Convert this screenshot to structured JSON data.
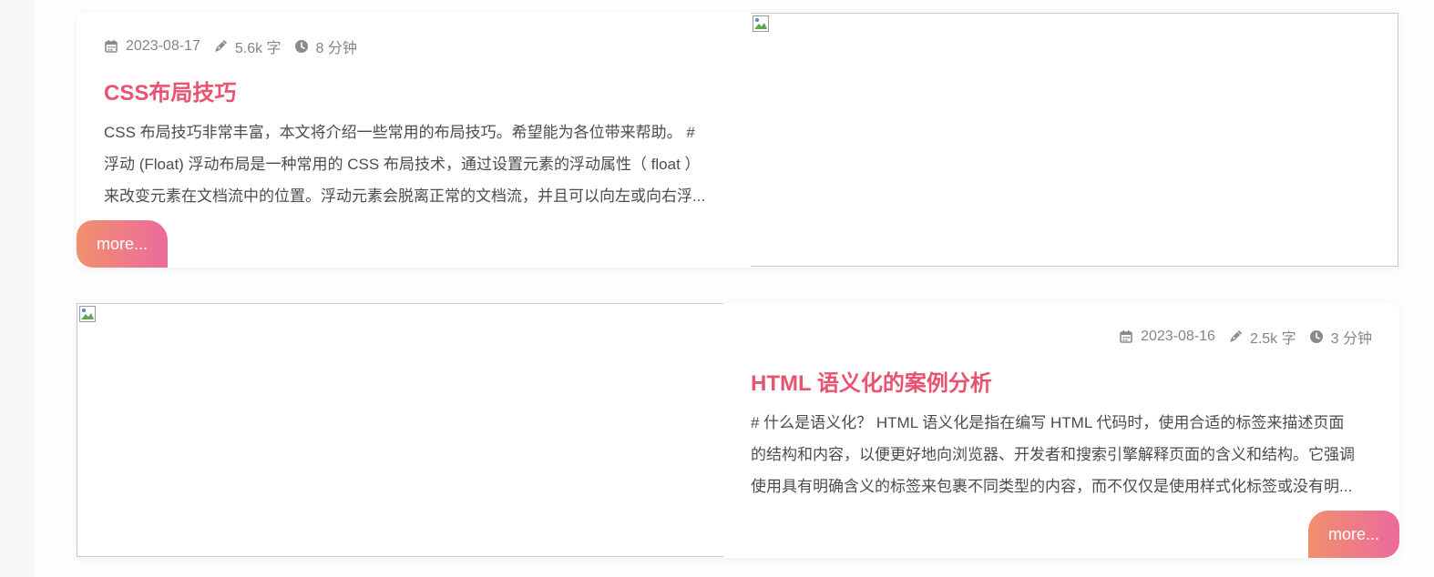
{
  "posts": [
    {
      "date": "2023-08-17",
      "words": "5.6k 字",
      "read_time": "8 分钟",
      "title": "CSS布局技巧",
      "excerpt_lines": [
        "CSS 布局技巧非常丰富，本文将介绍一些常用的布局技巧。希望能为各位带来帮助。 #",
        "浮动 (Float) 浮动布局是一种常用的 CSS 布局技术，通过设置元素的浮动属性（ float ）",
        "来改变元素在文档流中的位置。浮动元素会脱离正常的文档流，并且可以向左或向右浮..."
      ],
      "more_label": "more..."
    },
    {
      "date": "2023-08-16",
      "words": "2.5k 字",
      "read_time": "3 分钟",
      "title": "HTML 语义化的案例分析",
      "excerpt_lines": [
        "# 什么是语义化？ HTML 语义化是指在编写 HTML 代码时，使用合适的标签来描述页面",
        "的结构和内容，以便更好地向浏览器、开发者和搜索引擎解释页面的含义和结构。它强调",
        "使用具有明确含义的标签来包裹不同类型的内容，而不仅仅是使用样式化标签或没有明..."
      ],
      "more_label": "more..."
    }
  ],
  "icons": {
    "date": "calendar-icon",
    "words": "pen-icon",
    "read_time": "clock-icon"
  },
  "colors": {
    "title": "#e8536f",
    "meta": "#858585",
    "excerpt": "#4c4c4c",
    "button_gradient_start": "#f0906e",
    "button_gradient_end": "#ec6b9a"
  }
}
